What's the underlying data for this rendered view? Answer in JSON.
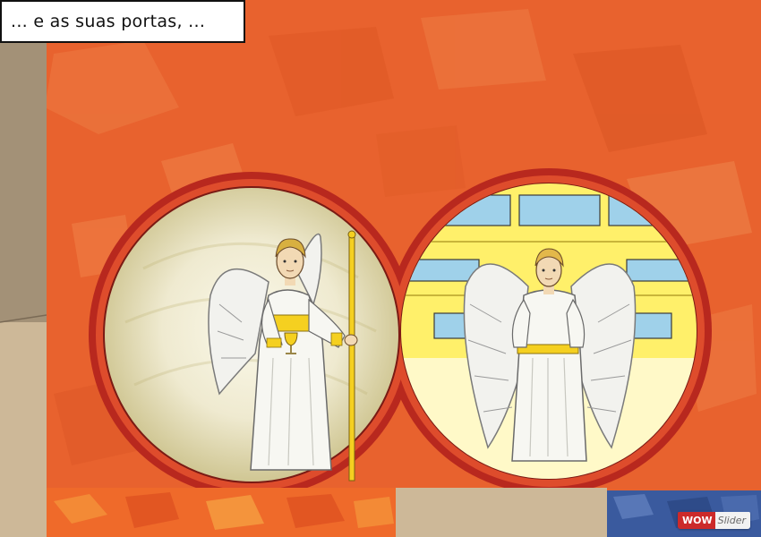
{
  "caption": {
    "text": "... e as suas portas, ..."
  },
  "watermark": {
    "part1": "WOW",
    "part2": "Slider"
  },
  "colors": {
    "wall_orange": "#e8622e",
    "ring_red": "#b8281e",
    "left_window_glow": "#f3efd2",
    "right_window_yellow": "#fff06a",
    "window_glass_blue": "#9fd1ea",
    "robe_white": "#f7f7f2",
    "gold": "#f5d020",
    "stone_tan": "#cdb898",
    "mosaic_blue": "#3a5a9e"
  },
  "figures": {
    "left": {
      "name": "angel-with-chalice-and-staff"
    },
    "right": {
      "name": "angel-with-gold-belt"
    }
  }
}
